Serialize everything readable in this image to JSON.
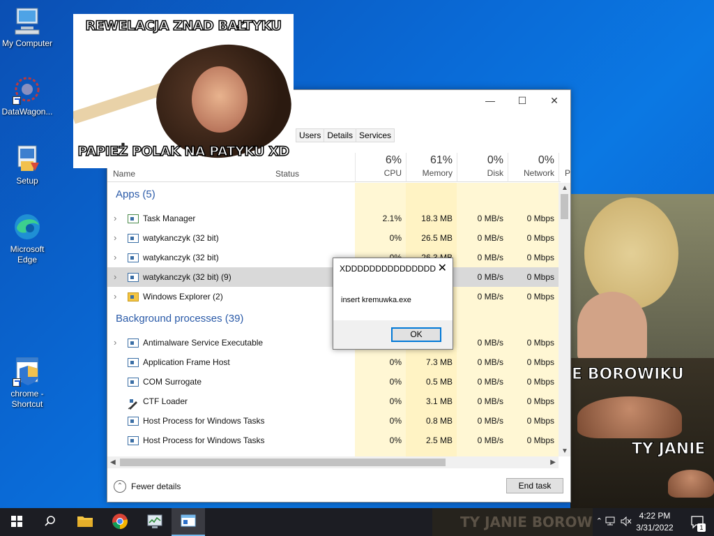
{
  "desktop": {
    "icons": [
      {
        "label": "My Computer"
      },
      {
        "label": "DataWagon..."
      },
      {
        "label": "Setup"
      },
      {
        "label": "Microsoft Edge"
      },
      {
        "label": "chrome - Shortcut"
      }
    ]
  },
  "meme1": {
    "top_caption": "REWELACJA ZNAD BAŁTYKU",
    "bottom_caption": "PAPIEŻ POLAK NA PATYKU XD"
  },
  "meme2": {
    "caption1": "E BOROWIKU",
    "caption2": "TY JANIE",
    "caption3": "TY JANIE BOROW"
  },
  "task_manager": {
    "tabs": [
      "Users",
      "Details",
      "Services"
    ],
    "columns": {
      "name": "Name",
      "status": "Status",
      "cpu": {
        "pct": "6%",
        "label": "CPU"
      },
      "memory": {
        "pct": "61%",
        "label": "Memory"
      },
      "disk": {
        "pct": "0%",
        "label": "Disk"
      },
      "network": {
        "pct": "0%",
        "label": "Network"
      },
      "power_stub": "P"
    },
    "groups": {
      "apps": "Apps (5)",
      "background": "Background processes (39)"
    },
    "apps": [
      {
        "name": "Task Manager",
        "cpu": "2.1%",
        "mem": "18.3 MB",
        "disk": "0 MB/s",
        "net": "0 Mbps"
      },
      {
        "name": "watykanczyk (32 bit)",
        "cpu": "0%",
        "mem": "26.5 MB",
        "disk": "0 MB/s",
        "net": "0 Mbps"
      },
      {
        "name": "watykanczyk (32 bit)",
        "cpu": "0%",
        "mem": "26.3 MB",
        "disk": "0 MB/s",
        "net": "0 Mbps"
      },
      {
        "name": "watykanczyk (32 bit) (9)",
        "cpu": "",
        "mem": "",
        "disk": "0 MB/s",
        "net": "0 Mbps"
      },
      {
        "name": "Windows Explorer (2)",
        "cpu": "",
        "mem": "",
        "disk": "0 MB/s",
        "net": "0 Mbps"
      }
    ],
    "background": [
      {
        "name": "Antimalware Service Executable",
        "cpu": "",
        "mem": "",
        "disk": "0 MB/s",
        "net": "0 Mbps"
      },
      {
        "name": "Application Frame Host",
        "cpu": "0%",
        "mem": "7.3 MB",
        "disk": "0 MB/s",
        "net": "0 Mbps"
      },
      {
        "name": "COM Surrogate",
        "cpu": "0%",
        "mem": "0.5 MB",
        "disk": "0 MB/s",
        "net": "0 Mbps"
      },
      {
        "name": "CTF Loader",
        "cpu": "0%",
        "mem": "3.1 MB",
        "disk": "0 MB/s",
        "net": "0 Mbps"
      },
      {
        "name": "Host Process for Windows Tasks",
        "cpu": "0%",
        "mem": "0.8 MB",
        "disk": "0 MB/s",
        "net": "0 Mbps"
      },
      {
        "name": "Host Process for Windows Tasks",
        "cpu": "0%",
        "mem": "2.5 MB",
        "disk": "0 MB/s",
        "net": "0 Mbps"
      }
    ],
    "footer": {
      "fewer_details": "Fewer details",
      "end_task": "End task"
    }
  },
  "dialog": {
    "title": "XDDDDDDDDDDDDDDD",
    "message": "insert kremuwka.exe",
    "ok": "OK"
  },
  "taskbar": {
    "time": "4:22 PM",
    "date": "3/31/2022",
    "notification_count": "1"
  },
  "colors": {
    "accent": "#0078d7",
    "group_header": "#2a5aa8",
    "column_highlight": "#fff7d4"
  }
}
